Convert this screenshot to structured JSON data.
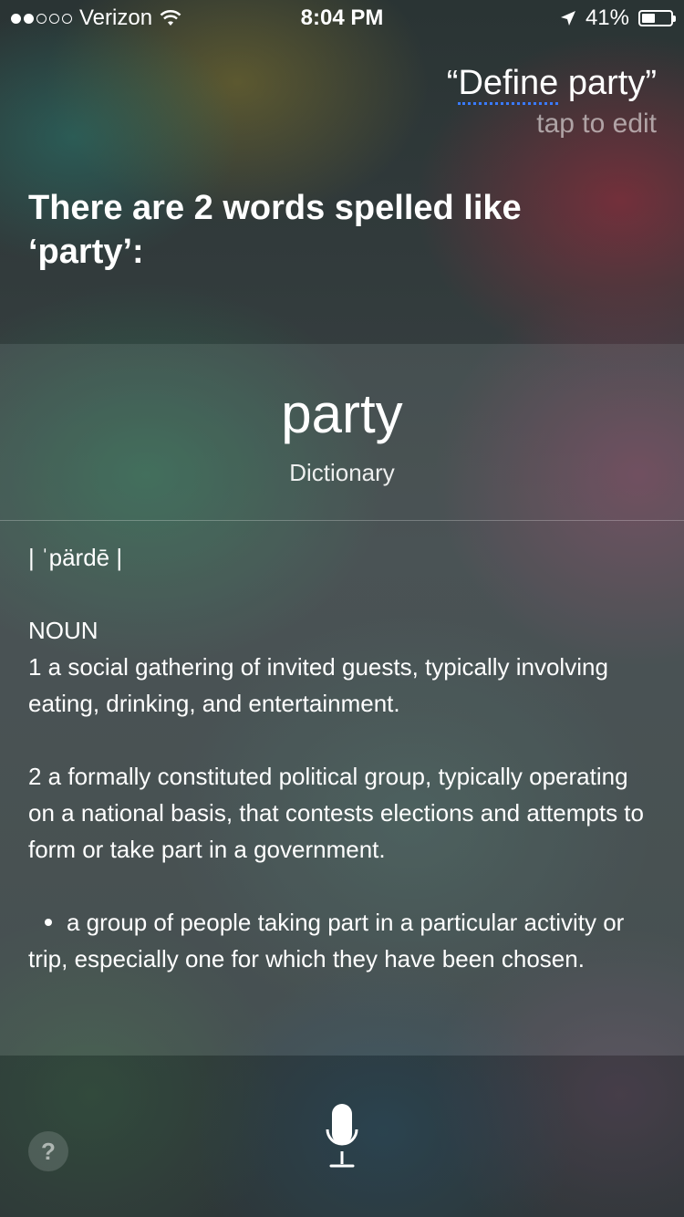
{
  "status_bar": {
    "carrier": "Verizon",
    "time": "8:04 PM",
    "battery": "41%",
    "signal_bars_filled": 2,
    "signal_bars_total": 5
  },
  "query": {
    "open_quote": "“",
    "underlined": "Define",
    "rest": " party”",
    "tap_to_edit": "tap to edit"
  },
  "answer": {
    "title": "There are 2 words spelled like ‘party’:"
  },
  "card": {
    "word": "party",
    "source": "Dictionary",
    "pronunciation": "| ˈpärdē |",
    "part_of_speech": "NOUN",
    "definitions": [
      "1  a social gathering of invited guests, typically involving eating, drinking, and entertainment.",
      "2  a formally constituted political group, typically operating on a national basis, that contests elections and attempts to form or take part in a government."
    ],
    "sub_definition": "a group of people taking part in a particular activity or trip, especially one for which they have been chosen."
  },
  "bottom": {
    "help_label": "?",
    "icons": [
      "help-icon",
      "microphone-icon"
    ]
  }
}
